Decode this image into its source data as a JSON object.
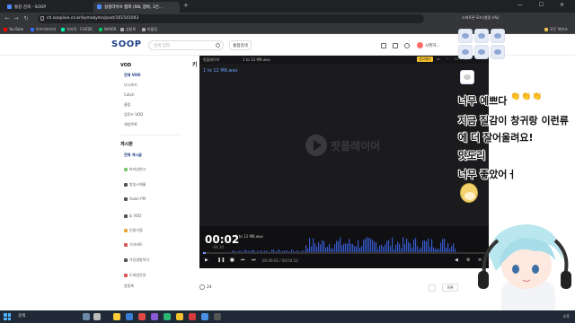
{
  "browser": {
    "tabs": [
      {
        "label": "통합 검색 - SOOP",
        "active": false
      },
      {
        "label": "실생라이브 캠피 (SN, 엠바, 1인…",
        "active": true
      }
    ],
    "new_tab": "+",
    "window_controls": "— ☐ ✕",
    "url": "ch.sooplive.co.kr/kymakyma/post/161541043",
    "bookmarks": [
      "YouTube",
      "아프리카티비",
      "치지직 - CHZZK",
      "NAVER",
      "심청록",
      "마블링"
    ],
    "bookmarks_right": [
      "모든 북마크"
    ],
    "profile_right": "스마트폰 모드(설정 ⅹ%)"
  },
  "site": {
    "logo": "SOOP",
    "search_placeholder": "검색 입력",
    "integrated_search": "통합검색",
    "user_name": "시쥐하..."
  },
  "sidebar": {
    "vod_heading": "VOD",
    "vod_items": [
      "전체 VOD",
      "다시보기",
      "Catch",
      "클립",
      "업로드 VOD",
      "재생목록"
    ],
    "board_heading": "게시판",
    "board_items": [
      "전체 게시글",
      "마라샹연시",
      "방송스케줄",
      "Asian FM",
      "& VOD",
      "인방기점",
      "기가비트",
      "가딩말말막기",
      "도와받은방",
      "방청록"
    ]
  },
  "post": {
    "title_prefix": "키",
    "likes": "24",
    "list_button": "목록"
  },
  "player": {
    "top_left": "팟플레이어",
    "top_filename": "1 to 12 MR.wav",
    "yellow_button": "광고제거",
    "file_label": "1 to 12 MR.wav",
    "watermark": "팟플레이어",
    "time_big": "00:02",
    "time_sub": "-04:10",
    "track_name": "1 to 12 MR.wav",
    "ctrl_time": "00:00:02 / 00:04:12",
    "progress": 0.01
  },
  "chat": {
    "lines": [
      "너무 예쁘다",
      "지금 질감이 창귀랑 이런류",
      "에 더 잘어울려요!",
      "맛도리",
      "너무 좋았어ㅓ"
    ]
  },
  "taskbar": {
    "search": "검색",
    "time": "오후"
  },
  "colors": {
    "soop_blue": "#1f3f8a",
    "player_bg": "#1b1b1d",
    "accent": "#7b9cff"
  }
}
